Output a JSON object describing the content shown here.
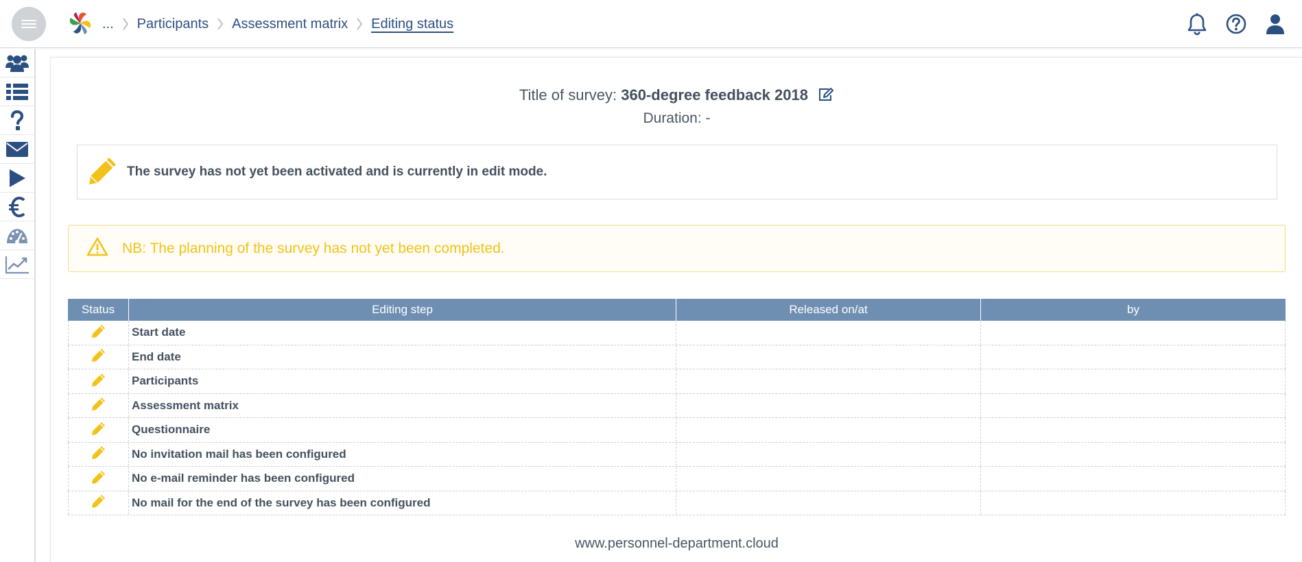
{
  "header": {
    "breadcrumbs": [
      {
        "label": "..."
      },
      {
        "label": "Participants"
      },
      {
        "label": "Assessment matrix"
      },
      {
        "label": "Editing status"
      }
    ]
  },
  "icons": {
    "menu": "hamburger-menu-icon",
    "logo": "colorful-swirl-logo",
    "notifications": "bell-icon",
    "help": "help-circle-icon",
    "user": "user-icon",
    "sidebar": [
      "users-group-icon",
      "list-icon",
      "question-icon",
      "envelope-icon",
      "play-icon",
      "euro-icon",
      "dashboard-gauge-icon",
      "line-chart-icon"
    ],
    "status": "pencil-icon"
  },
  "colors": {
    "nav_blue": "#2c4f82",
    "table_header": "#6f8fb2",
    "pencil_yellow": "#f2c21b",
    "warning_text": "#f2c21b"
  },
  "survey": {
    "title_label": "Title of survey:",
    "title_value": "360-degree feedback 2018",
    "duration_label": "Duration:",
    "duration_value": "-"
  },
  "notice": {
    "text": "The survey has not yet been activated and is currently in edit mode."
  },
  "warning": {
    "prefix": "NB",
    "text": ": The planning of the survey has not yet been completed."
  },
  "table": {
    "columns": [
      "Status",
      "Editing step",
      "Released on/at",
      "by"
    ],
    "rows": [
      {
        "step": "Start date",
        "released": "",
        "by": ""
      },
      {
        "step": "End date",
        "released": "",
        "by": ""
      },
      {
        "step": "Participants",
        "released": "",
        "by": ""
      },
      {
        "step": "Assessment matrix",
        "released": "",
        "by": ""
      },
      {
        "step": "Questionnaire",
        "released": "",
        "by": ""
      },
      {
        "step": "No invitation mail has been configured",
        "released": "",
        "by": ""
      },
      {
        "step": "No e-mail reminder has been configured",
        "released": "",
        "by": ""
      },
      {
        "step": "No mail for the end of the survey has been configured",
        "released": "",
        "by": ""
      }
    ]
  },
  "footer": {
    "text": "www.personnel-department.cloud"
  }
}
